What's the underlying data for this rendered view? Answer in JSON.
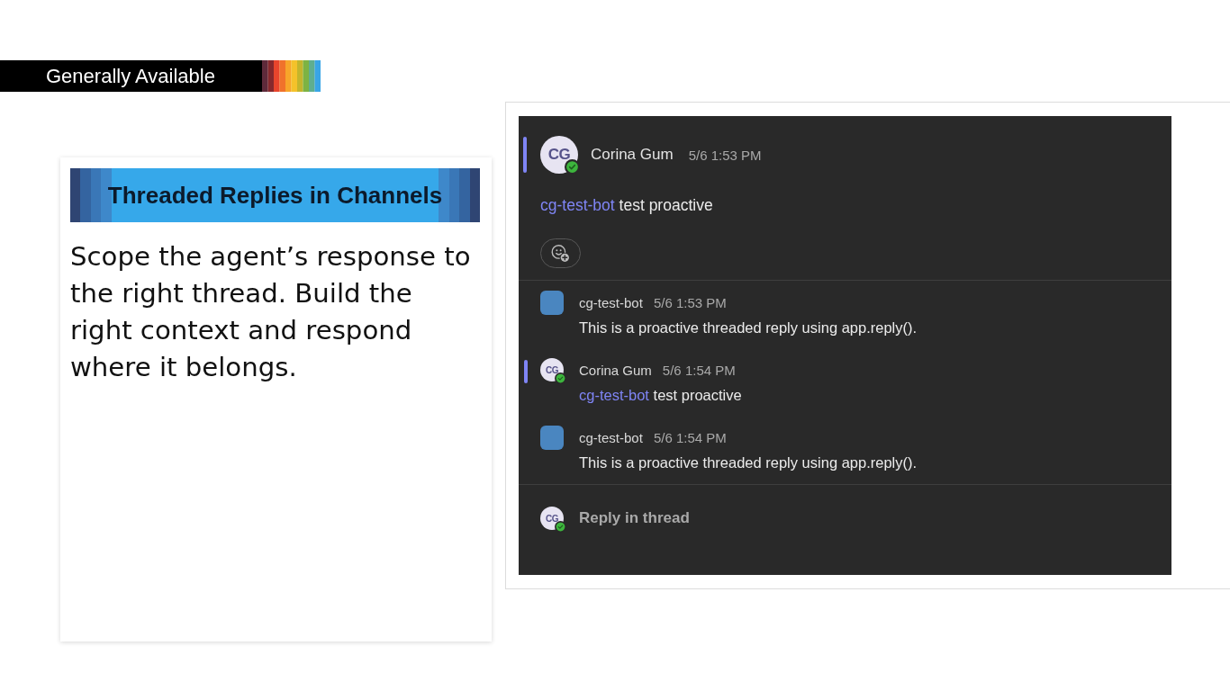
{
  "badge": {
    "label": "Generally Available"
  },
  "feature": {
    "title": "Threaded Replies in Channels",
    "description": "Scope the agent’s response to the right thread. Build the right context and respond where it belongs."
  },
  "thread": {
    "post": {
      "kind": "person",
      "initials": "CG",
      "author": "Corina Gum",
      "time": "5/6 1:53 PM",
      "accent": true,
      "online": true,
      "mention": "cg-test-bot",
      "text": "test proactive"
    },
    "replies": [
      {
        "kind": "bot",
        "author": "cg-test-bot",
        "time": "5/6 1:53 PM",
        "accent": false,
        "text": "This is a proactive threaded reply using app.reply()."
      },
      {
        "kind": "person",
        "initials": "CG",
        "author": "Corina Gum",
        "time": "5/6 1:54 PM",
        "accent": true,
        "online": true,
        "mention": "cg-test-bot",
        "text": "test proactive"
      },
      {
        "kind": "bot",
        "author": "cg-test-bot",
        "time": "5/6 1:54 PM",
        "accent": false,
        "text": "This is a proactive threaded reply using app.reply()."
      }
    ],
    "composer": {
      "kind": "person",
      "initials": "CG",
      "online": true,
      "placeholder": "Reply in thread"
    }
  }
}
